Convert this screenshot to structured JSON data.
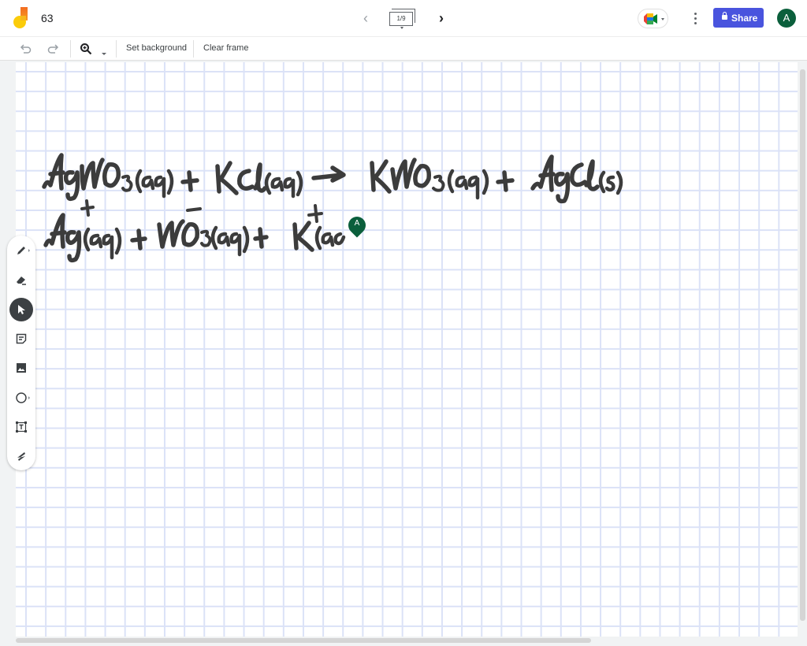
{
  "header": {
    "title": "63",
    "frame_indicator": "1/9",
    "share_label": "Share",
    "avatar_initial": "A",
    "brand_color": "#4954de",
    "avatar_color": "#0b5f3c"
  },
  "toolbar": {
    "undo_icon": "undo-icon",
    "redo_icon": "redo-icon",
    "zoom_icon": "zoom-in-icon",
    "set_background_label": "Set background",
    "clear_frame_label": "Clear frame"
  },
  "side_tools": [
    {
      "name": "pen",
      "icon": "pen-icon",
      "active": false
    },
    {
      "name": "eraser",
      "icon": "eraser-icon",
      "active": false
    },
    {
      "name": "select",
      "icon": "pointer-icon",
      "active": true
    },
    {
      "name": "sticky-note",
      "icon": "sticky-note-icon",
      "active": false
    },
    {
      "name": "image",
      "icon": "image-icon",
      "active": false
    },
    {
      "name": "shape",
      "icon": "circle-icon",
      "active": false
    },
    {
      "name": "text-box",
      "icon": "text-box-icon",
      "active": false
    },
    {
      "name": "laser",
      "icon": "laser-icon",
      "active": false
    }
  ],
  "canvas": {
    "background": "grid",
    "handwriting": [
      "AgNO3(aq) + KCl(aq) → KNO3(aq) + AgCl(s)",
      "Ag+(aq) + NO3−(aq) + K+(aq"
    ],
    "collaborator_pin": "A"
  }
}
